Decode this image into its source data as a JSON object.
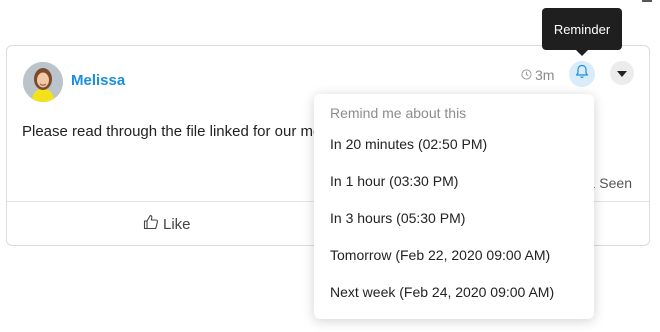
{
  "post": {
    "author": "Melissa",
    "time": "3m",
    "message": "Please read through the file linked for our me",
    "seen": "1 Seen",
    "like_label": "Like"
  },
  "tooltip": {
    "text": "Reminder"
  },
  "reminder_menu": {
    "header": "Remind me about this",
    "items": [
      {
        "label": "In 20 minutes (02:50 PM)"
      },
      {
        "label": "In 1 hour (03:30 PM)"
      },
      {
        "label": "In 3 hours (05:30 PM)"
      },
      {
        "label": "Tomorrow (Feb 22, 2020 09:00 AM)"
      },
      {
        "label": "Next week (Feb 24, 2020 09:00 AM)"
      }
    ]
  },
  "icons": {
    "clock": "clock-icon",
    "bell": "bell-icon",
    "caret": "caret-down-icon",
    "like": "thumbs-up-icon"
  },
  "colors": {
    "accent": "#1a8fe0",
    "bell_bg": "#d9ecfb",
    "tooltip_bg": "#1f1f1f",
    "muted": "#8c8c8c"
  }
}
